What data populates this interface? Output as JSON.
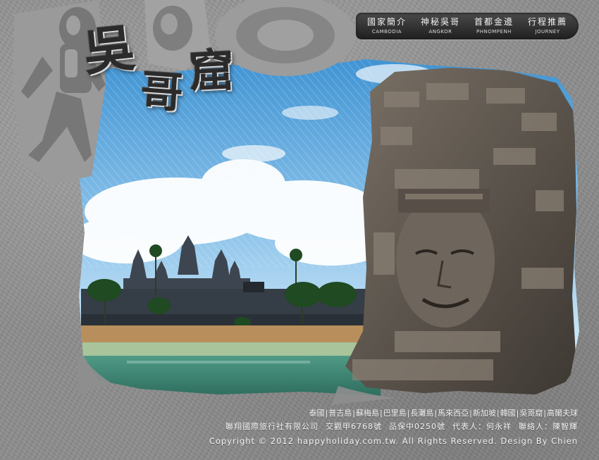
{
  "logo": {
    "chars": [
      "吳",
      "哥",
      "窟"
    ]
  },
  "nav": {
    "items": [
      {
        "zh": "國家簡介",
        "en": "CAMBODIA"
      },
      {
        "zh": "神秘吳哥",
        "en": "ANGKOR"
      },
      {
        "zh": "首都金邊",
        "en": "PHNOMPENH"
      },
      {
        "zh": "行程推薦",
        "en": "JOURNEY"
      }
    ]
  },
  "footer": {
    "links": [
      "泰國",
      "普吉島",
      "蘇梅島",
      "巴里島",
      "長灘島",
      "馬來西亞",
      "新加坡",
      "韓國",
      "吳哥窟",
      "高爾夫球"
    ],
    "company": "聯翔國際旅行社有限公司",
    "license": "交觀甲6768號",
    "insurance": "品保中0250號",
    "representative": "代表人：何永祥",
    "contact": "聯絡人：陳智輝",
    "copyright": "Copyright © 2012 happyholiday.com.tw. All Rights Reserved. Design By Chien"
  },
  "colors": {
    "stone": "#8e8e8e",
    "nav": "#2b2b2b",
    "sky": "#7fbbe6",
    "text": "#f4f4f4"
  }
}
